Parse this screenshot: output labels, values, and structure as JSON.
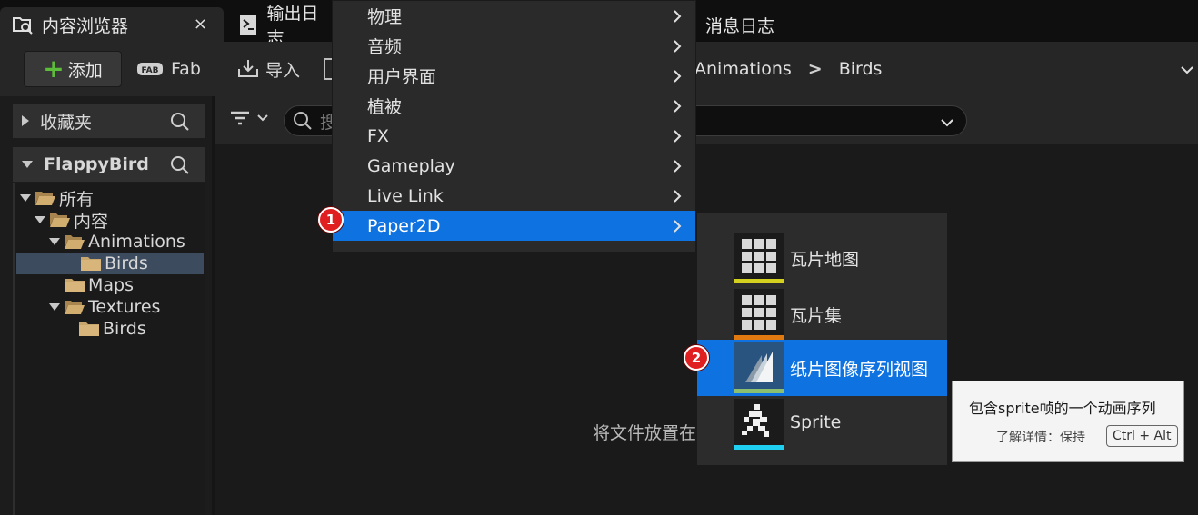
{
  "tabs": {
    "content_browser": "内容浏览器",
    "output_log": "输出日志",
    "message_log": "消息日志",
    "close_glyph": "×"
  },
  "toolbar": {
    "add_label": "添加",
    "fab_label": "Fab",
    "import_label": "导入",
    "path": [
      "Animations",
      "Birds"
    ]
  },
  "sidebar": {
    "favorites_label": "收藏夹",
    "project_label": "FlappyBird",
    "tree": [
      {
        "label": "所有",
        "depth": 0,
        "expanded": true
      },
      {
        "label": "内容",
        "depth": 1,
        "expanded": true
      },
      {
        "label": "Animations",
        "depth": 2,
        "expanded": true
      },
      {
        "label": "Birds",
        "depth": 3,
        "selected": true
      },
      {
        "label": "Maps",
        "depth": 2
      },
      {
        "label": "Textures",
        "depth": 2,
        "expanded": true
      },
      {
        "label": "Birds",
        "depth": 3
      }
    ]
  },
  "search": {
    "placeholder": "搜"
  },
  "main": {
    "drop_hint": "将文件放置在"
  },
  "menu": {
    "items": [
      {
        "label": "物理"
      },
      {
        "label": "音频"
      },
      {
        "label": "用户界面"
      },
      {
        "label": "植被"
      },
      {
        "label": "FX"
      },
      {
        "label": "Gameplay"
      },
      {
        "label": "Live Link"
      },
      {
        "label": "Paper2D",
        "highlighted": true
      }
    ]
  },
  "submenu": {
    "items": [
      {
        "label": "瓦片地图",
        "icon": "tile-map-icon",
        "accent": "#d4d020"
      },
      {
        "label": "瓦片集",
        "icon": "tile-set-icon",
        "accent": "#e07a10"
      },
      {
        "label": "纸片图像序列视图",
        "icon": "flipbook-icon",
        "accent": "#8cc070",
        "highlighted": true
      },
      {
        "label": "Sprite",
        "icon": "sprite-icon",
        "accent": "#20d0f0"
      }
    ]
  },
  "tooltip": {
    "title": "包含sprite帧的一个动画序列",
    "more": "了解详情：保持",
    "shortcut": "Ctrl + Alt"
  },
  "badges": [
    "1",
    "2"
  ],
  "colors": {
    "highlight": "#0e72e0",
    "add_plus": "#5bbd3a",
    "folder": "#c9a66b",
    "badge": "#e02020"
  }
}
